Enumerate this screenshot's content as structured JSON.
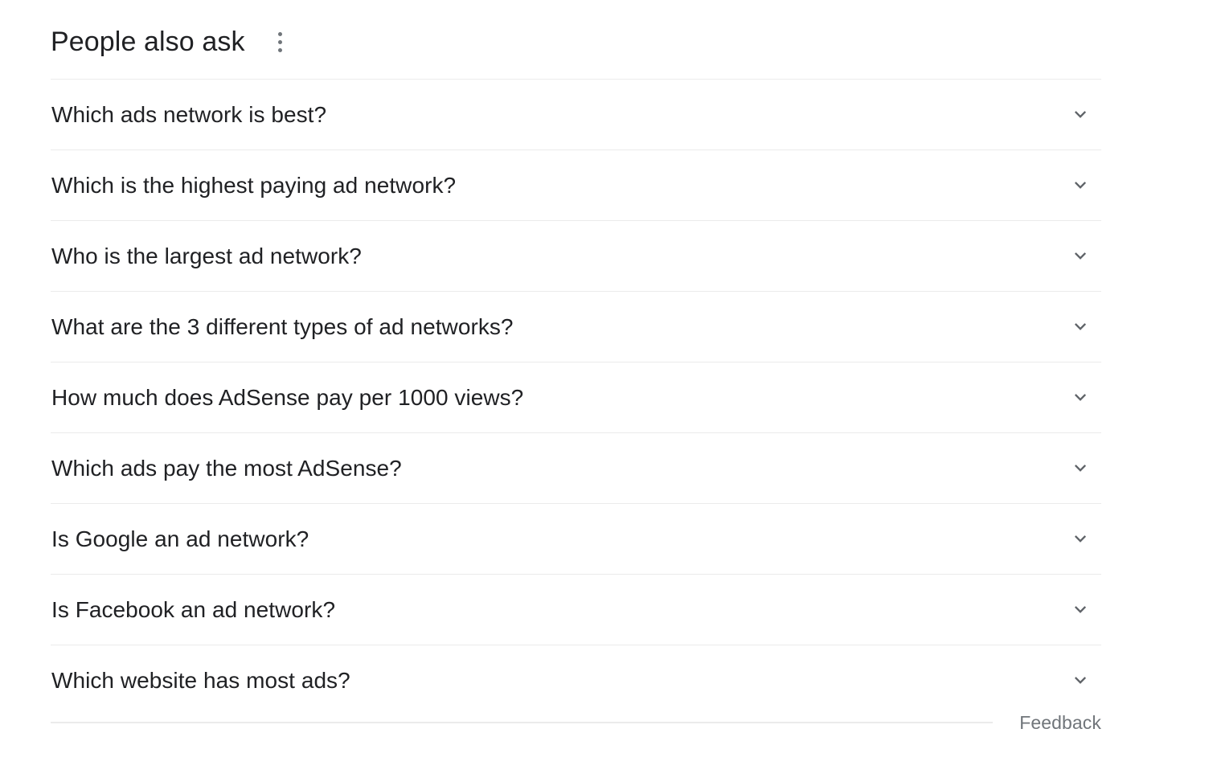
{
  "module": {
    "title": "People also ask",
    "menu_icon": "more-vert-icon",
    "expand_icon": "chevron-down-icon",
    "colors": {
      "text": "#202124",
      "muted": "#70757a",
      "icon": "#5f6368",
      "divider": "#ebebeb",
      "background": "#ffffff"
    }
  },
  "questions": [
    {
      "text": "Which ads network is best?"
    },
    {
      "text": "Which is the highest paying ad network?"
    },
    {
      "text": "Who is the largest ad network?"
    },
    {
      "text": "What are the 3 different types of ad networks?"
    },
    {
      "text": "How much does AdSense pay per 1000 views?"
    },
    {
      "text": "Which ads pay the most AdSense?"
    },
    {
      "text": "Is Google an ad network?"
    },
    {
      "text": "Is Facebook an ad network?"
    },
    {
      "text": "Which website has most ads?"
    }
  ],
  "footer": {
    "feedback_label": "Feedback"
  }
}
